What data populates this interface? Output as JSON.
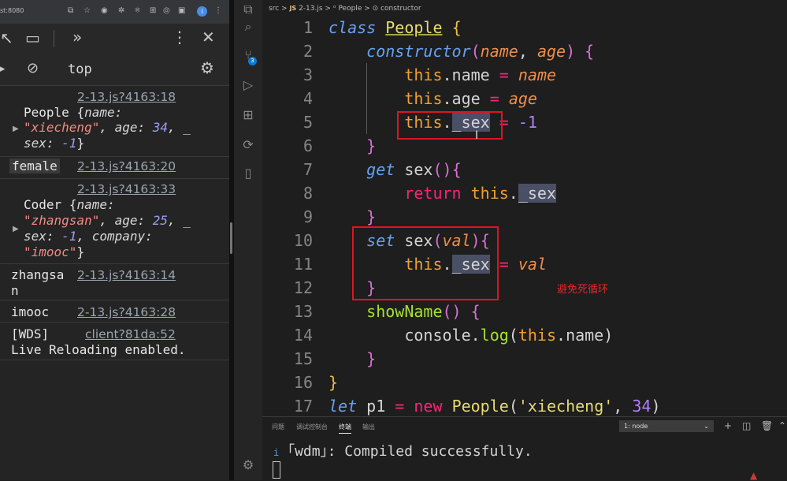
{
  "browser": {
    "url_fragment": "st:8080"
  },
  "devtools": {
    "context": "top",
    "console": [
      {
        "source": "2-13.js?4163:18",
        "obj_label": "People",
        "lines": [
          [
            "{",
            "name:"
          ],
          [
            "\"xiecheng\"",
            ", age: ",
            "34",
            ", _"
          ],
          [
            "sex:",
            " -1",
            "}"
          ]
        ]
      },
      {
        "text": "female",
        "source": "2-13.js?4163:20"
      },
      {
        "source": "2-13.js?4163:33",
        "obj_label": "Coder",
        "lines": [
          [
            "{",
            "name:"
          ],
          [
            "\"zhangsan\"",
            ", age: ",
            "25",
            ", _"
          ],
          [
            "sex:",
            " -1",
            ", company:"
          ],
          [
            "\"imooc\"",
            "}"
          ]
        ]
      },
      {
        "text1": "zhangsa",
        "text2": "n",
        "source": "2-13.js?4163:14"
      },
      {
        "text": "imooc",
        "source": "2-13.js?4163:28"
      },
      {
        "text1": "[WDS]",
        "source": "client?81da:52",
        "text2": "Live Reloading enabled."
      }
    ]
  },
  "editor": {
    "breadcrumb": [
      "src",
      ">",
      "JS",
      "2-13.js",
      ">",
      "People",
      ">",
      "constructor"
    ],
    "badge_count": "3",
    "line_numbers": [
      "1",
      "2",
      "3",
      "4",
      "5",
      "6",
      "7",
      "8",
      "9",
      "10",
      "11",
      "12",
      "13",
      "14",
      "15",
      "16",
      "17"
    ],
    "annotation": "避免死循环"
  },
  "panel": {
    "tabs": [
      "问题",
      "调试控制台",
      "终端",
      "输出"
    ],
    "active_tab": "终端",
    "terminal_select": "1: node",
    "terminal_prefix": "i",
    "terminal_output": "｢wdm｣: Compiled successfully."
  }
}
